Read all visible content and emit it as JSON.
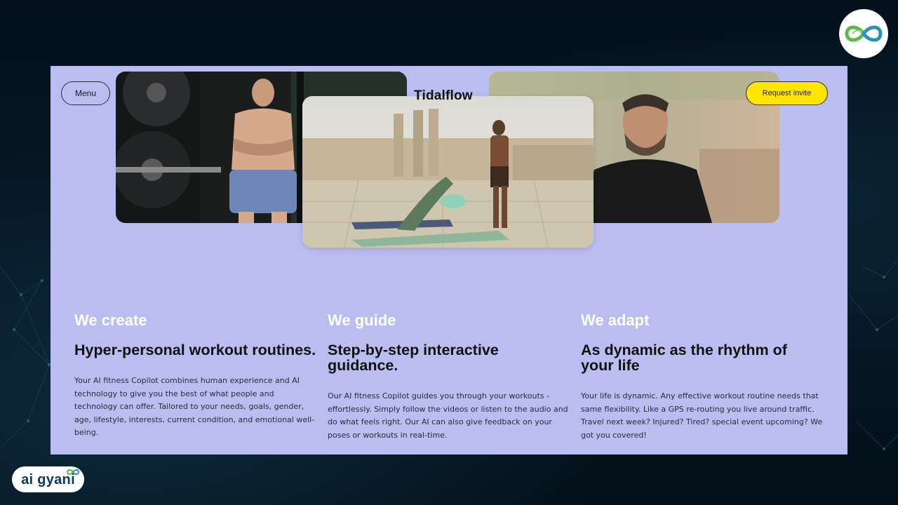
{
  "header": {
    "menu_label": "Menu",
    "brand": "Tidalflow",
    "invite_label": "Request invite"
  },
  "features": [
    {
      "kicker": "We create",
      "title": "Hyper-personal workout routines.",
      "body": "Your AI fitness Copilot combines human experience and AI technology to give you the best of what people and technology can offer. Tailored to your needs, goals, gender, age, lifestyle, interests, current condition, and emotional well-being."
    },
    {
      "kicker": "We guide",
      "title": "Step-by-step interactive guidance.",
      "body": "Our AI fitness Copilot guides you through your workouts - effortlessly. Simply follow the videos or listen to the audio and do what feels right. Our AI can also give feedback on your poses or workouts in real-time."
    },
    {
      "kicker": "We adapt",
      "title": "As dynamic as the rhythm of your life",
      "body": "Your life is dynamic. Any effective workout routine needs that same flexibility. Like a GPS re-routing you live around traffic. Travel next week? Injured? Tired? special event upcoming? We got you covered!"
    }
  ],
  "watermark": {
    "text": "ai gyani"
  },
  "colors": {
    "panel": "#babdf0",
    "invite_button": "#ffe500",
    "kicker": "#ffffff",
    "title": "#111111"
  },
  "icons": [
    "infinity-leaf-icon"
  ]
}
